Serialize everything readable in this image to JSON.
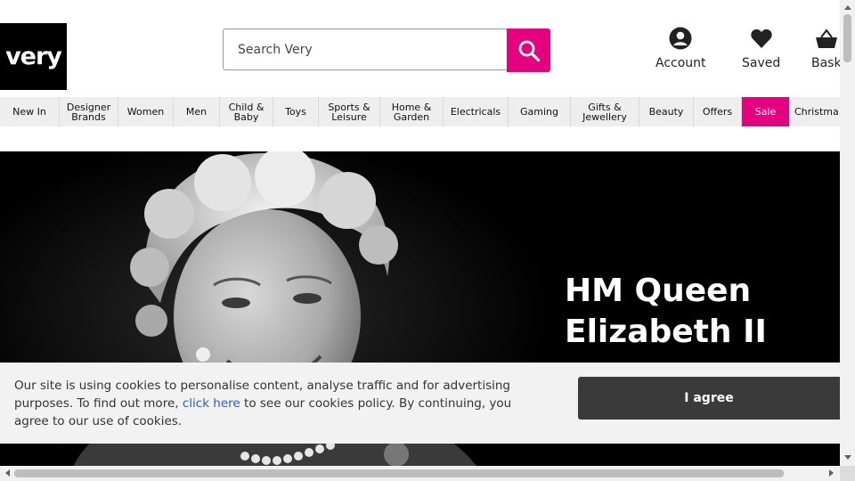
{
  "header": {
    "logo_text": "very",
    "search_placeholder": "Search Very",
    "links": [
      {
        "label": "Account",
        "icon": "account-icon"
      },
      {
        "label": "Saved",
        "icon": "heart-icon"
      },
      {
        "label": "Bask",
        "icon": "basket-icon"
      }
    ]
  },
  "nav": {
    "items": [
      {
        "label": "New In"
      },
      {
        "label": "Designer Brands"
      },
      {
        "label": "Women"
      },
      {
        "label": "Men"
      },
      {
        "label": "Child & Baby"
      },
      {
        "label": "Toys"
      },
      {
        "label": "Sports & Leisure"
      },
      {
        "label": "Home & Garden"
      },
      {
        "label": "Electricals"
      },
      {
        "label": "Gaming"
      },
      {
        "label": "Gifts & Jewellery"
      },
      {
        "label": "Beauty"
      },
      {
        "label": "Offers"
      },
      {
        "label": "Sale"
      },
      {
        "label": "Christma"
      }
    ]
  },
  "hero": {
    "title": "HM Queen Elizabeth II"
  },
  "cookie": {
    "text_before": "Our site is using cookies to personalise content, analyse traffic and for advertising purposes. To find out more, ",
    "link": "click here",
    "text_after": " to see our cookies policy. By continuing, you agree to our use of cookies.",
    "button": "I agree"
  },
  "colors": {
    "brand_pink": "#e5007e",
    "logo_bg": "#000000",
    "cookie_button": "#3a3a3a"
  }
}
